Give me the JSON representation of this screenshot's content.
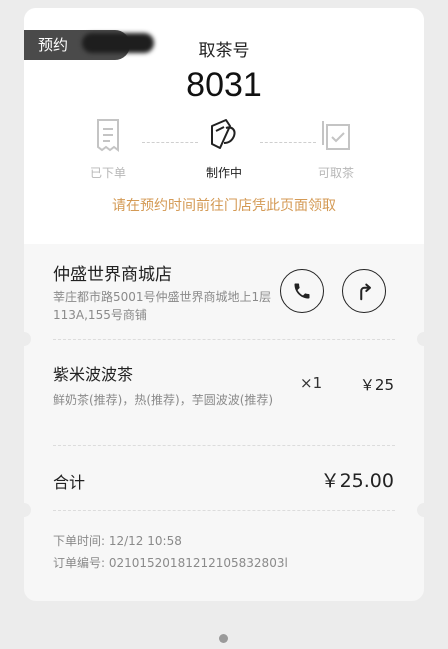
{
  "order": {
    "badge": "预约",
    "pickup_label": "取茶号",
    "pickup_number": "8031",
    "steps": [
      {
        "label": "已下单",
        "state": "done"
      },
      {
        "label": "制作中",
        "state": "current"
      },
      {
        "label": "可取茶",
        "state": "todo"
      }
    ],
    "notice": "请在预约时间前往门店凭此页面领取"
  },
  "store": {
    "name": "仲盛世界商城店",
    "address": "莘庄都市路5001号仲盛世界商城地上1层113A,155号商铺",
    "call_icon": "phone-icon",
    "nav_icon": "directions-icon"
  },
  "items": [
    {
      "name": "紫米波波茶",
      "spec": "鲜奶茶(推荐)，热(推荐)，芋圆波波(推荐)",
      "qty": "×1",
      "price": "￥25"
    }
  ],
  "total": {
    "label": "合计",
    "value": "￥25.00"
  },
  "meta": {
    "time": "下单时间:  12/12 10:58",
    "number": "订单编号:  02101520181212105832803l"
  },
  "colors": {
    "accent": "#d49a55",
    "badge_bg": "#4a4a4a",
    "background": "#ececec"
  }
}
